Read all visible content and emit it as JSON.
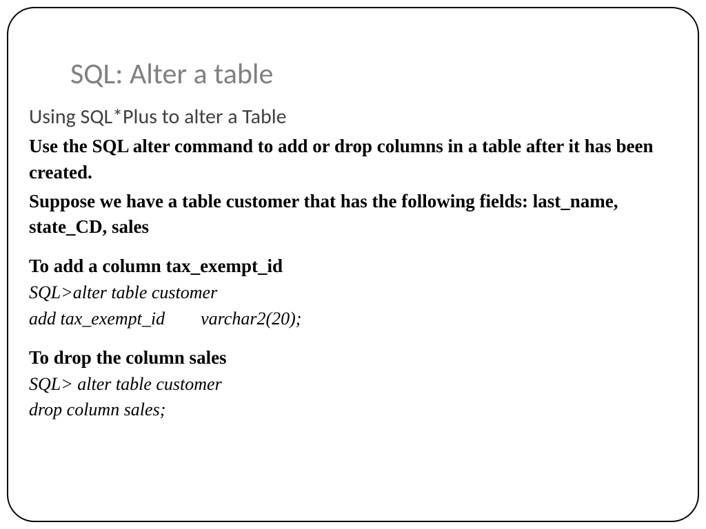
{
  "title": "SQL:  Alter a table",
  "subtitle": "Using SQL*Plus to alter a Table",
  "intro1": "Use the SQL alter command to add or drop columns in a table after it has been created.",
  "intro2": "Suppose we have a table customer that has the following fields: last_name, state_CD, sales",
  "section1_heading": "To add a column tax_exempt_id",
  "section1_code1": "SQL>alter table customer",
  "section1_code2": "add tax_exempt_id        varchar2(20);",
  "section2_heading": "To drop the column sales",
  "section2_code1": "SQL> alter table customer",
  "section2_code2": "drop column sales;"
}
